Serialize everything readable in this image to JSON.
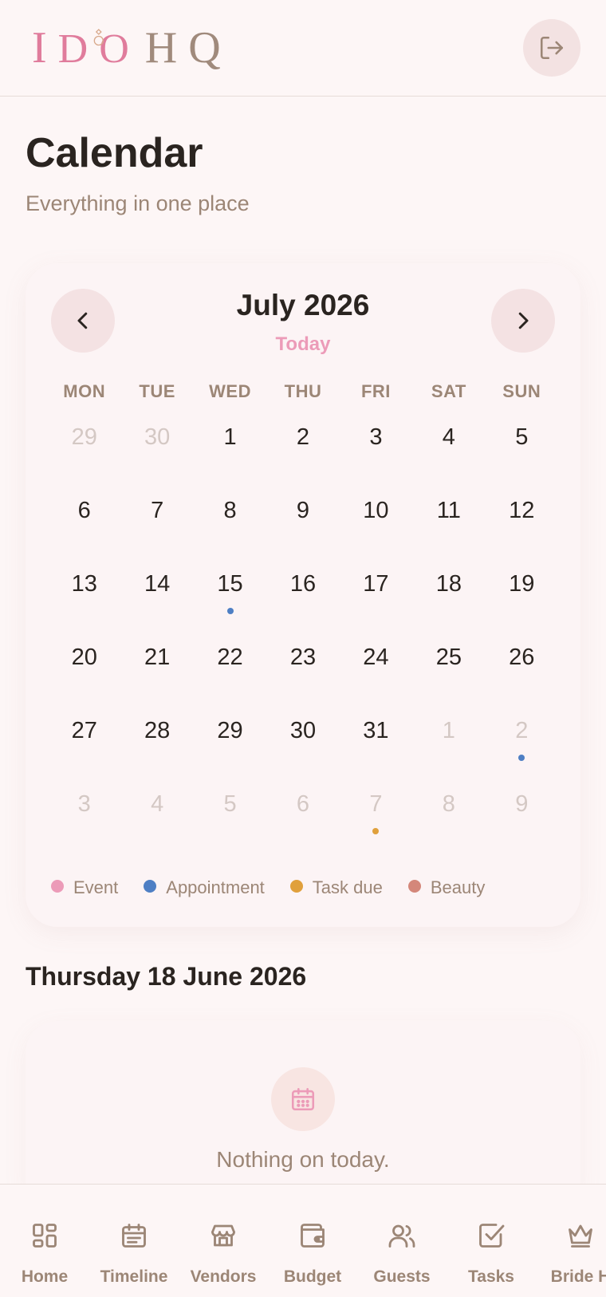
{
  "app": {
    "logo_part1": "I",
    "logo_part2": "DO",
    "logo_part3": "HQ"
  },
  "page": {
    "title": "Calendar",
    "subtitle": "Everything in one place"
  },
  "calendar": {
    "month_label": "July 2026",
    "today_label": "Today",
    "weekdays": [
      "MON",
      "TUE",
      "WED",
      "THU",
      "FRI",
      "SAT",
      "SUN"
    ],
    "days": [
      {
        "n": "29",
        "muted": true
      },
      {
        "n": "30",
        "muted": true
      },
      {
        "n": "1"
      },
      {
        "n": "2"
      },
      {
        "n": "3"
      },
      {
        "n": "4"
      },
      {
        "n": "5"
      },
      {
        "n": "6"
      },
      {
        "n": "7"
      },
      {
        "n": "8"
      },
      {
        "n": "9"
      },
      {
        "n": "10"
      },
      {
        "n": "11"
      },
      {
        "n": "12"
      },
      {
        "n": "13"
      },
      {
        "n": "14"
      },
      {
        "n": "15",
        "dot": "appointment"
      },
      {
        "n": "16"
      },
      {
        "n": "17"
      },
      {
        "n": "18"
      },
      {
        "n": "19"
      },
      {
        "n": "20"
      },
      {
        "n": "21"
      },
      {
        "n": "22"
      },
      {
        "n": "23"
      },
      {
        "n": "24"
      },
      {
        "n": "25"
      },
      {
        "n": "26"
      },
      {
        "n": "27"
      },
      {
        "n": "28"
      },
      {
        "n": "29"
      },
      {
        "n": "30"
      },
      {
        "n": "31"
      },
      {
        "n": "1",
        "muted": true
      },
      {
        "n": "2",
        "muted": true,
        "dot": "appointment"
      },
      {
        "n": "3",
        "muted": true
      },
      {
        "n": "4",
        "muted": true
      },
      {
        "n": "5",
        "muted": true
      },
      {
        "n": "6",
        "muted": true
      },
      {
        "n": "7",
        "muted": true,
        "dot": "task"
      },
      {
        "n": "8",
        "muted": true
      },
      {
        "n": "9",
        "muted": true
      }
    ],
    "legend": [
      {
        "key": "event",
        "label": "Event",
        "color": "#ec9bb8"
      },
      {
        "key": "appointment",
        "label": "Appointment",
        "color": "#4e7fc4"
      },
      {
        "key": "task",
        "label": "Task due",
        "color": "#e0a03c"
      },
      {
        "key": "beauty",
        "label": "Beauty",
        "color": "#d4877a"
      }
    ]
  },
  "selected": {
    "date_label": "Thursday 18 June 2026",
    "empty_text": "Nothing on today."
  },
  "bottom_nav": {
    "items": [
      {
        "label": "Home",
        "icon": "home-grid-icon"
      },
      {
        "label": "Timeline",
        "icon": "calendar-icon"
      },
      {
        "label": "Vendors",
        "icon": "store-icon"
      },
      {
        "label": "Budget",
        "icon": "wallet-icon"
      },
      {
        "label": "Guests",
        "icon": "users-icon"
      },
      {
        "label": "Tasks",
        "icon": "checkbox-icon"
      },
      {
        "label": "Bride H",
        "icon": "crown-icon"
      }
    ]
  },
  "colors": {
    "accent_pink": "#ec9bb8",
    "taupe": "#9c8676",
    "background": "#fdf6f6"
  }
}
